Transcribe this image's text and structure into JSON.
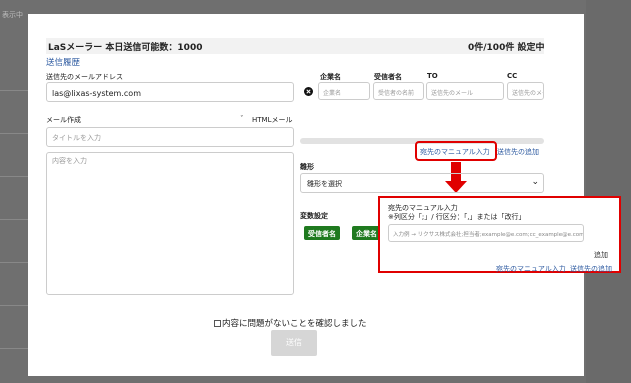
{
  "background": {
    "label": "表示中"
  },
  "header": {
    "title": "LaSメーラー 本日送信可能数：1000",
    "count": "0件/100件 設定中",
    "history_link": "送信履歴"
  },
  "email": {
    "label": "送信先のメールアドレス",
    "value": "las@lixas-system.com"
  },
  "compose": {
    "label": "メール作成",
    "toggle": "ˇ",
    "html_label": "HTMLメール",
    "title_placeholder": "タイトルを入力",
    "body_placeholder": "内容を入力"
  },
  "recipients": {
    "columns": [
      "企業名",
      "受信者名",
      "TO",
      "CC"
    ],
    "placeholders": [
      "企業名",
      "受信者の名前",
      "送信先のメール",
      "送信先のメー"
    ]
  },
  "links": {
    "manual_input": "宛先のマニュアル入力",
    "add_recipient": "送信先の追加"
  },
  "template": {
    "label": "雛形",
    "select_value": "雛形を選択"
  },
  "variables": {
    "label": "変数設定",
    "tags": [
      "受信者名",
      "企業名"
    ]
  },
  "popup": {
    "title_line1": "宛先のマニュアル入力",
    "title_line2": "※列区分「;」/ 行区分：「,」または「改行」",
    "input_placeholder": "入力例 → リクサス株式会社;担当者;example@e.com;cc_example@e.com",
    "add_label": "追加",
    "bottom_manual": "宛先のマニュアル入力",
    "bottom_add": "送信先の追加"
  },
  "confirm": {
    "label": "内容に問題がないことを確認しました"
  },
  "send": {
    "label": "送信"
  },
  "colors": {
    "accent_red": "#e00000",
    "tag_green": "#1f7a1f",
    "link_blue": "#2d5aa0"
  }
}
